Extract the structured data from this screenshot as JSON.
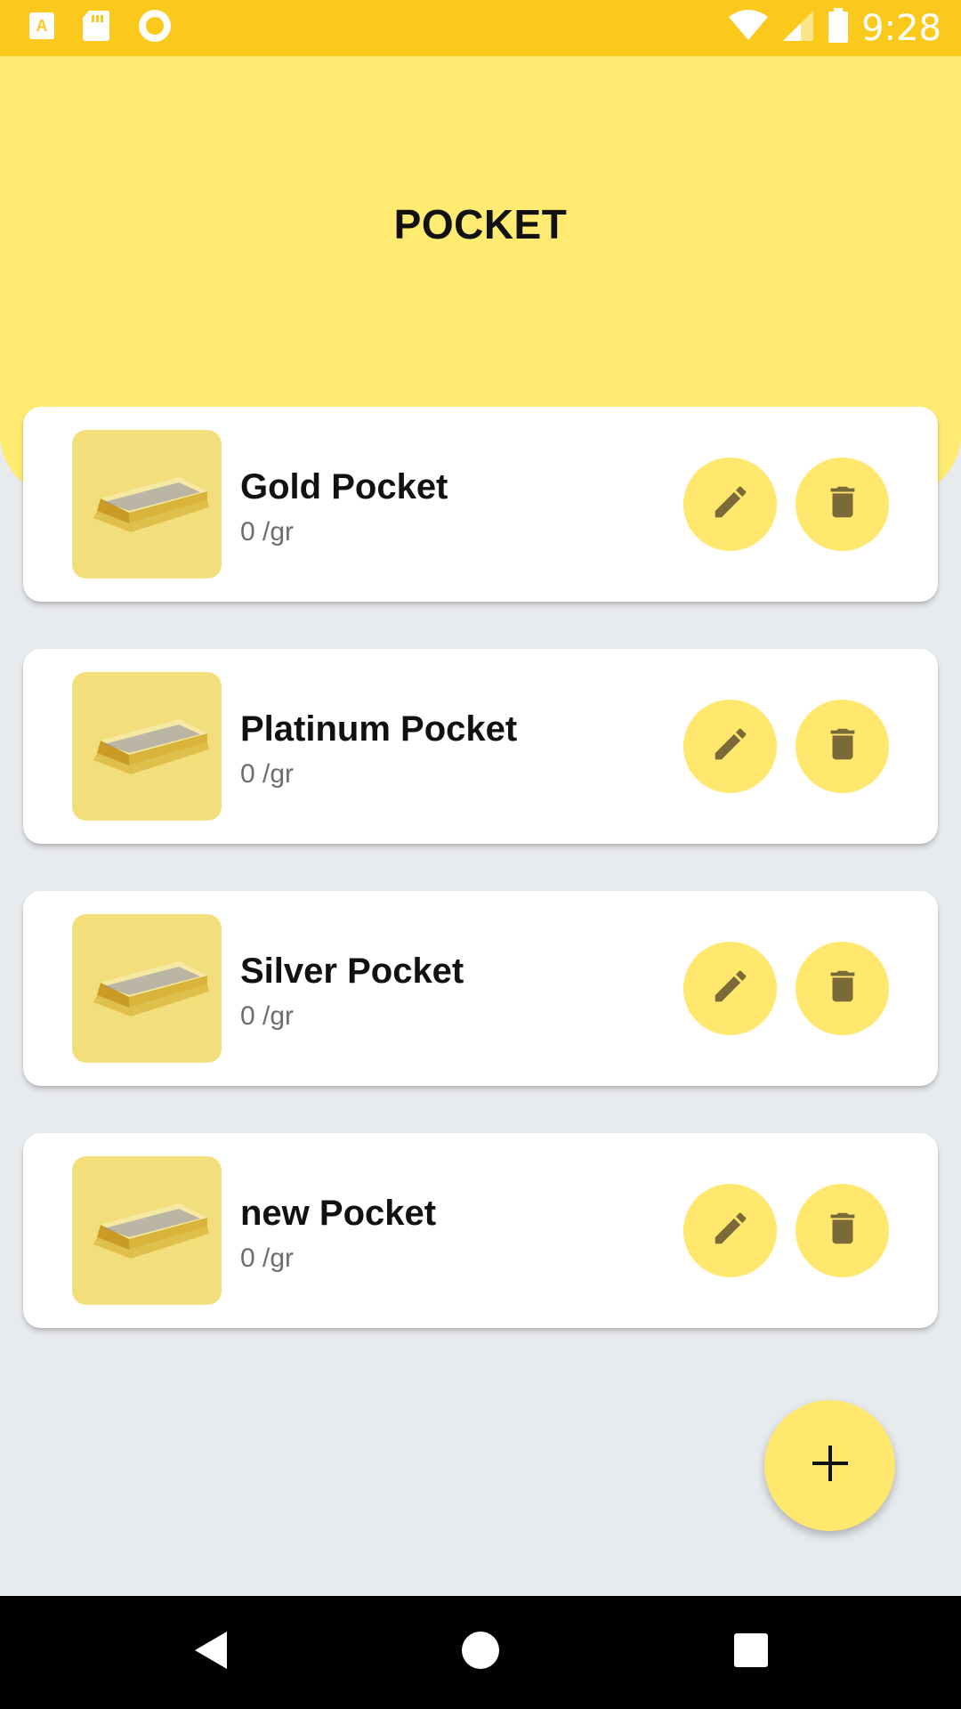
{
  "status_bar": {
    "time": "9:28",
    "icons": [
      "text-a-icon",
      "sd-card-icon",
      "sync-circle-icon",
      "wifi-icon",
      "signal-icon",
      "battery-icon"
    ]
  },
  "header": {
    "title": "POCKET"
  },
  "pockets": [
    {
      "name": "Gold Pocket",
      "weight": "0 /gr"
    },
    {
      "name": "Platinum Pocket",
      "weight": "0 /gr"
    },
    {
      "name": "Silver Pocket",
      "weight": "0 /gr"
    },
    {
      "name": "new Pocket",
      "weight": "0 /gr"
    }
  ],
  "fab": {
    "icon": "plus-icon"
  },
  "nav_bar": {
    "icons": [
      "back-icon",
      "home-icon",
      "recents-icon"
    ]
  },
  "colors": {
    "status_bar": "#fbc91c",
    "header": "#ffea72",
    "button": "#ffe86d",
    "icon": "#7a6a37",
    "background": "#e8ebee"
  }
}
